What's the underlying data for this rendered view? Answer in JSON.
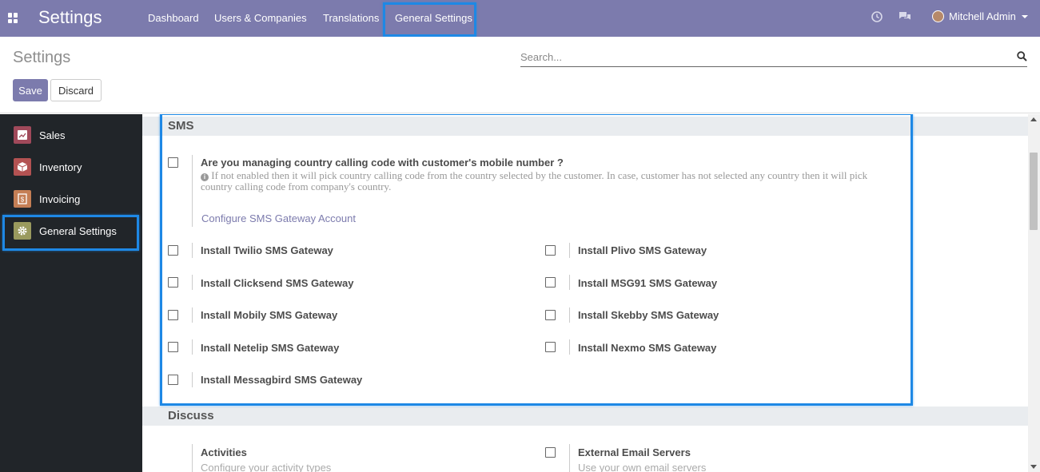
{
  "topbar": {
    "title": "Settings",
    "menu": [
      "Dashboard",
      "Users & Companies",
      "Translations",
      "General Settings"
    ],
    "user_name": "Mitchell Admin",
    "accent_color": "#7c7bad"
  },
  "control_panel": {
    "title": "Settings",
    "search_placeholder": "Search...",
    "save_label": "Save",
    "discard_label": "Discard"
  },
  "sidebar": {
    "items": [
      {
        "label": "Sales",
        "icon": "sales-icon"
      },
      {
        "label": "Inventory",
        "icon": "inventory-icon"
      },
      {
        "label": "Invoicing",
        "icon": "invoicing-icon"
      },
      {
        "label": "General Settings",
        "icon": "gear-icon"
      }
    ]
  },
  "sms": {
    "heading": "SMS",
    "country_code_label": "Are you managing country calling code with customer's mobile number ?",
    "country_code_help_1": "If not enabled then it will pick country calling code from the country selected by the customer. In case, customer has not selected any country then it will pick",
    "country_code_help_2": "country calling code from company's country.",
    "configure_link": "Configure SMS Gateway Account",
    "gateways_left": [
      "Install Twilio SMS Gateway",
      "Install Clicksend SMS Gateway",
      "Install Mobily SMS Gateway",
      "Install Netelip SMS Gateway",
      "Install Messagbird SMS Gateway"
    ],
    "gateways_right": [
      "Install Plivo SMS Gateway",
      "Install MSG91 SMS Gateway",
      "Install Skebby SMS Gateway",
      "Install Nexmo SMS Gateway"
    ]
  },
  "discuss": {
    "heading": "Discuss",
    "activities_label": "Activities",
    "activities_sub": "Configure your activity types",
    "external_email_label": "External Email Servers",
    "external_email_sub": "Use your own email servers"
  }
}
